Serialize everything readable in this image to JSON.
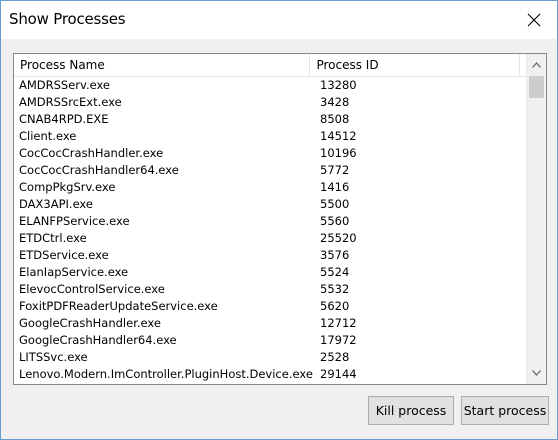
{
  "window": {
    "title": "Show Processes"
  },
  "table": {
    "columns": [
      "Process Name",
      "Process ID"
    ],
    "rows": [
      {
        "name": "AMDRSServ.exe",
        "pid": "13280"
      },
      {
        "name": "AMDRSSrcExt.exe",
        "pid": "3428"
      },
      {
        "name": "CNAB4RPD.EXE",
        "pid": "8508"
      },
      {
        "name": "Client.exe",
        "pid": "14512"
      },
      {
        "name": "CocCocCrashHandler.exe",
        "pid": "10196"
      },
      {
        "name": "CocCocCrashHandler64.exe",
        "pid": "5772"
      },
      {
        "name": "CompPkgSrv.exe",
        "pid": "1416"
      },
      {
        "name": "DAX3API.exe",
        "pid": "5500"
      },
      {
        "name": "ELANFPService.exe",
        "pid": "5560"
      },
      {
        "name": "ETDCtrl.exe",
        "pid": "25520"
      },
      {
        "name": "ETDService.exe",
        "pid": "3576"
      },
      {
        "name": "ElanIapService.exe",
        "pid": "5524"
      },
      {
        "name": "ElevocControlService.exe",
        "pid": "5532"
      },
      {
        "name": "FoxitPDFReaderUpdateService.exe",
        "pid": "5620"
      },
      {
        "name": "GoogleCrashHandler.exe",
        "pid": "12712"
      },
      {
        "name": "GoogleCrashHandler64.exe",
        "pid": "17972"
      },
      {
        "name": "LITSSvc.exe",
        "pid": "2528"
      },
      {
        "name": "Lenovo.Modern.ImController.PluginHost.Device.exe",
        "pid": "29144"
      }
    ],
    "scroll_position": 0.0
  },
  "buttons": {
    "kill": "Kill process",
    "start": "Start process"
  },
  "icons": {
    "close": "close-icon",
    "scroll_up": "chevron-up-icon",
    "scroll_down": "chevron-down-icon"
  }
}
